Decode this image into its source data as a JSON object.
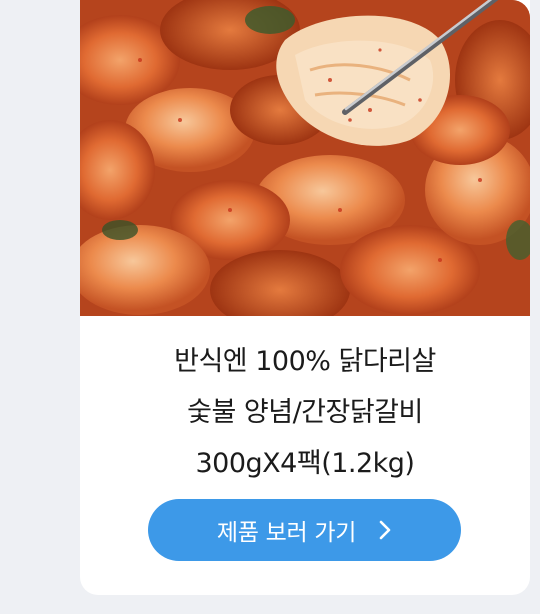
{
  "product": {
    "image_alt": "spicy chicken galbi stir-fry lifted with chopsticks",
    "title_lines": [
      "반식엔 100% 닭다리살",
      "숯불 양념/간장닭갈비",
      "300gX4팩(1.2kg)"
    ],
    "cta_label": "제품 보러 가기",
    "cta_icon": "chevron-right-icon"
  },
  "colors": {
    "page_bg": "#eef0f4",
    "card_bg": "#ffffff",
    "button": "#3d99e8",
    "title_text": "#1b1b1b"
  }
}
